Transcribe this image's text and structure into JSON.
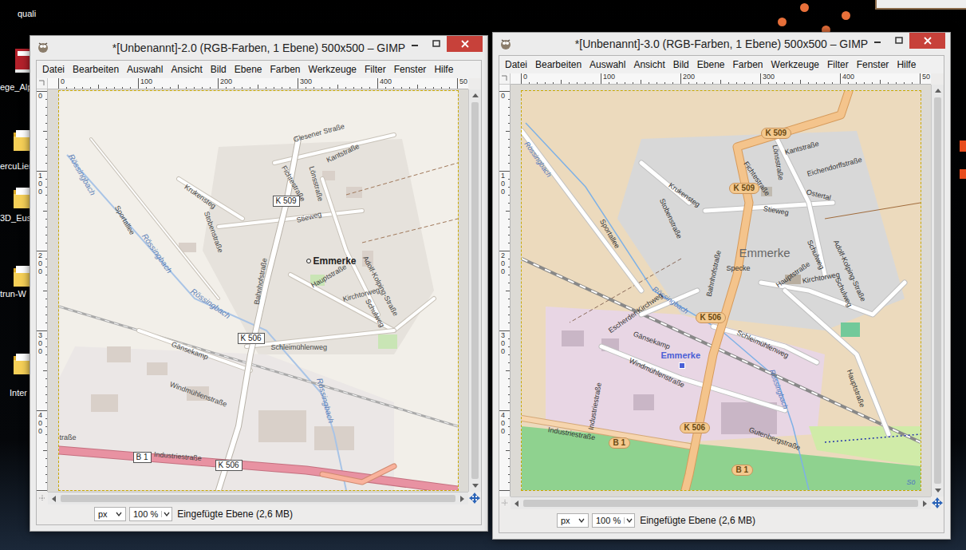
{
  "desktop": {
    "icons": [
      {
        "label": "quali"
      },
      {
        "label": "ege_Alp"
      },
      {
        "label": "ercuLier"
      },
      {
        "label": "3D_Eus"
      },
      {
        "label": "trun-W"
      },
      {
        "label": "Inter"
      }
    ]
  },
  "windows": [
    {
      "title": "*[Unbenannt]-2.0 (RGB-Farben, 1 Ebene) 500x500 – GIMP",
      "menu": [
        "Datei",
        "Bearbeiten",
        "Auswahl",
        "Ansicht",
        "Bild",
        "Ebene",
        "Farben",
        "Werkzeuge",
        "Filter",
        "Fenster",
        "Hilfe"
      ],
      "ruler_h": [
        "0",
        "100",
        "200",
        "300",
        "400",
        "50"
      ],
      "ruler_v": [
        "0",
        "100",
        "200",
        "300",
        "400"
      ],
      "map": {
        "kind": "standard",
        "labels": [
          {
            "text": "Giesener Straße",
            "kind": "road"
          },
          {
            "text": "Kantstraße",
            "kind": "road"
          },
          {
            "text": "Fichtestraße",
            "kind": "road"
          },
          {
            "text": "Lönsstraße",
            "kind": "road"
          },
          {
            "text": "Krukensteg",
            "kind": "road"
          },
          {
            "text": "K 509",
            "kind": "shield"
          },
          {
            "text": "Stobenstraße",
            "kind": "road"
          },
          {
            "text": "Stieweg",
            "kind": "road"
          },
          {
            "text": "Sportallee",
            "kind": "road"
          },
          {
            "text": "Rössingbach",
            "kind": "water"
          },
          {
            "text": "Rössingbach",
            "kind": "water"
          },
          {
            "text": "Emmerke",
            "kind": "place"
          },
          {
            "text": "Bahnhofstraße",
            "kind": "road"
          },
          {
            "text": "Hauptstraße",
            "kind": "road"
          },
          {
            "text": "Adolf-Kolping-Straße",
            "kind": "road"
          },
          {
            "text": "Kirchtorweg",
            "kind": "road"
          },
          {
            "text": "Schulweg",
            "kind": "road"
          },
          {
            "text": "Rössingbach",
            "kind": "water"
          },
          {
            "text": "Gänsekamp",
            "kind": "road"
          },
          {
            "text": "K 506",
            "kind": "shield"
          },
          {
            "text": "Schleimühlenweg",
            "kind": "road"
          },
          {
            "text": "Windmühlenstraße",
            "kind": "road"
          },
          {
            "text": "Rössingbach",
            "kind": "water"
          },
          {
            "text": "Industriestraße",
            "kind": "road"
          },
          {
            "text": "B 1",
            "kind": "shield"
          },
          {
            "text": "K 506",
            "kind": "shield"
          },
          {
            "text": "traße",
            "kind": "road"
          }
        ]
      },
      "status": {
        "unit": "px",
        "zoom": "100 %",
        "message": "Eingefügte Ebene (2,6 MB)"
      }
    },
    {
      "title": "*[Unbenannt]-3.0 (RGB-Farben, 1 Ebene) 500x500 – GIMP",
      "menu": [
        "Datei",
        "Bearbeiten",
        "Auswahl",
        "Ansicht",
        "Bild",
        "Ebene",
        "Farben",
        "Werkzeuge",
        "Filter",
        "Fenster",
        "Hilfe"
      ],
      "ruler_h": [
        "0",
        "100",
        "200",
        "300",
        "400",
        "50"
      ],
      "ruler_v": [
        "0",
        "100",
        "200",
        "300",
        "400"
      ],
      "map": {
        "kind": "topo",
        "labels": [
          {
            "text": "Rössingbach",
            "kind": "water"
          },
          {
            "text": "K 509",
            "kind": "shield"
          },
          {
            "text": "Lönsstraße",
            "kind": "road"
          },
          {
            "text": "Kantstraße",
            "kind": "road"
          },
          {
            "text": "Fichtestraße",
            "kind": "road"
          },
          {
            "text": "Eichendorffstraße",
            "kind": "road"
          },
          {
            "text": "Krukensteg",
            "kind": "road"
          },
          {
            "text": "K 509",
            "kind": "shield"
          },
          {
            "text": "Ostertal",
            "kind": "road"
          },
          {
            "text": "Stobenstraße",
            "kind": "road"
          },
          {
            "text": "Stieweg",
            "kind": "road"
          },
          {
            "text": "Sportallee",
            "kind": "road"
          },
          {
            "text": "Emmerke",
            "kind": "place"
          },
          {
            "text": "Bahnhofstraße",
            "kind": "road"
          },
          {
            "text": "Schulweg",
            "kind": "road"
          },
          {
            "text": "Adolf-Kolping-Straße",
            "kind": "road"
          },
          {
            "text": "Hauptstraße",
            "kind": "road"
          },
          {
            "text": "Specke",
            "kind": "road"
          },
          {
            "text": "Kirchtorweg",
            "kind": "road"
          },
          {
            "text": "Schulweg",
            "kind": "road"
          },
          {
            "text": "Rössingbach",
            "kind": "water"
          },
          {
            "text": "Escherder Kirchweg",
            "kind": "road"
          },
          {
            "text": "K 506",
            "kind": "shield"
          },
          {
            "text": "Gänsekamp",
            "kind": "road"
          },
          {
            "text": "Schleimühlenweg",
            "kind": "road"
          },
          {
            "text": "Emmerke",
            "kind": "station"
          },
          {
            "text": "Windmühlenstraße",
            "kind": "road"
          },
          {
            "text": "Rössingbach",
            "kind": "water"
          },
          {
            "text": "Hauptstraße",
            "kind": "road"
          },
          {
            "text": "Industriestraße",
            "kind": "road"
          },
          {
            "text": "Industriestraße",
            "kind": "road"
          },
          {
            "text": "B 1",
            "kind": "shield"
          },
          {
            "text": "K 506",
            "kind": "shield"
          },
          {
            "text": "Gutenbergstraße",
            "kind": "road"
          },
          {
            "text": "B 1",
            "kind": "shield"
          },
          {
            "text": "Sö",
            "kind": "water"
          }
        ]
      },
      "status": {
        "unit": "px",
        "zoom": "100 %",
        "message": "Eingefügte Ebene (2,6 MB)"
      }
    }
  ]
}
